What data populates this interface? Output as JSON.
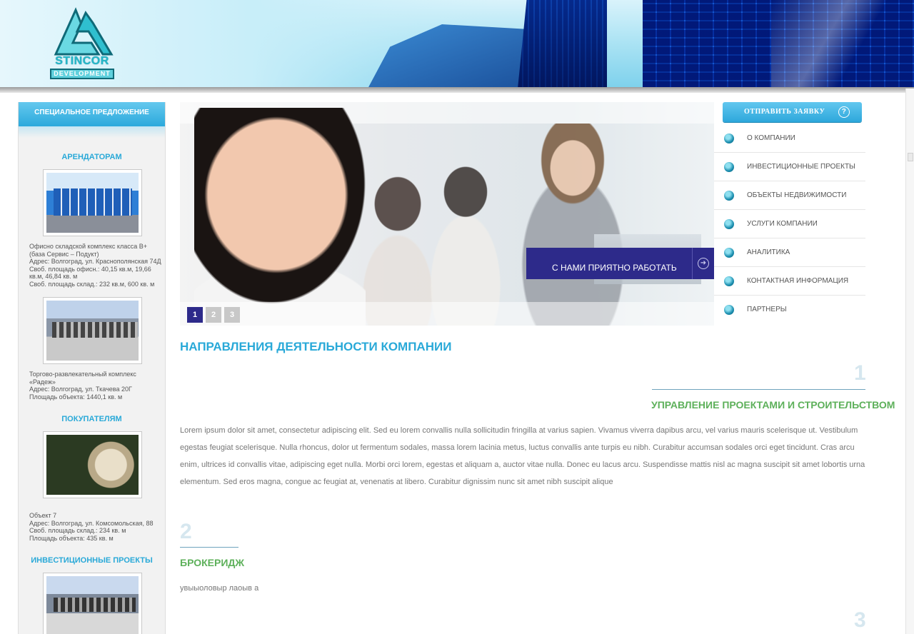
{
  "header": {
    "logo_main": "STINCOR",
    "logo_sub": "DEVELOPMENT"
  },
  "sidebar": {
    "title": "СПЕЦИАЛЬНОЕ ПРЕДЛОЖЕНИЕ",
    "sections": {
      "tenants": "АРЕНДАТОРАМ",
      "buyers": "ПОКУПАТЕЛЯМ",
      "investment": "ИНВЕСТИЦИОННЫЕ ПРОЕКТЫ"
    },
    "objects": [
      {
        "lines": [
          "Офисно складской комплекс класса В+",
          "(база Сервис – Подукт)",
          "Адрес: Волгоград, ул. Краснополянская 74Д",
          "Своб. площадь офисн.: 40,15 кв.м, 19,66",
          "кв.м, 46,84 кв. м",
          "Своб. площадь склад.: 232 кв.м, 600 кв. м"
        ]
      },
      {
        "lines": [
          "Торгово-развлекательный комплекс",
          "«Радеж»",
          "Адрес: Волгоград, ул. Ткачева 20Г",
          "Площадь объекта: 1440,1 кв. м"
        ]
      },
      {
        "lines": [
          "Объект 7",
          "Адрес: Волгоград, ул. Комсомольская, 88",
          "Своб. площадь склад.: 234 кв. м",
          "Площадь объекта: 435 кв. м"
        ]
      }
    ]
  },
  "slider": {
    "caption": "С НАМИ ПРИЯТНО РАБОТАТЬ",
    "pages": [
      "1",
      "2",
      "3"
    ],
    "active_page": "1"
  },
  "right_menu": {
    "order_button": "ОТПРАВИТЬ ЗАЯВКУ",
    "order_icon": "?",
    "items": [
      "О КОМПАНИИ",
      "ИНВЕСТИЦИОННЫЕ ПРОЕКТЫ",
      "ОБЪЕКТЫ НЕДВИЖИМОСТИ",
      "УСЛУГИ КОМПАНИИ",
      "АНАЛИТИКА",
      "КОНТАКТНАЯ ИНФОРМАЦИЯ",
      "ПАРТНЕРЫ"
    ]
  },
  "content": {
    "title": "НАПРАВЛЕНИЯ ДЕЯТЕЛЬНОСТИ КОМПАНИИ",
    "sections": [
      {
        "number": "1",
        "heading": "УПРАВЛЕНИЕ ПРОЕКТАМИ И СТРОИТЕЛЬСТВОМ",
        "text": "Lorem ipsum dolor sit amet, consectetur adipiscing elit. Sed eu lorem convallis nulla sollicitudin fringilla at varius sapien. Vivamus viverra dapibus arcu, vel varius mauris scelerisque ut. Vestibulum egestas feugiat scelerisque. Nulla rhoncus, dolor ut fermentum sodales, massa lorem lacinia metus, luctus convallis ante turpis eu nibh. Curabitur accumsan sodales orci eget tincidunt. Cras arcu enim, ultrices id convallis vitae, adipiscing eget nulla. Morbi orci lorem, egestas et aliquam a, auctor vitae nulla. Donec eu lacus arcu. Suspendisse mattis nisl ac magna suscipit sit amet lobortis urna elementum. Sed eros magna, congue ac feugiat at, venenatis at libero. Curabitur dignissim nunc sit amet nibh suscipit alique"
      },
      {
        "number": "2",
        "heading": "БРОКЕРИДЖ",
        "text": "увыыоловыр лаоыв а"
      },
      {
        "number": "3"
      }
    ]
  },
  "colors": {
    "accent_blue": "#29a9d8",
    "accent_green": "#5db05a",
    "caption_bg": "#2d2a8a"
  }
}
